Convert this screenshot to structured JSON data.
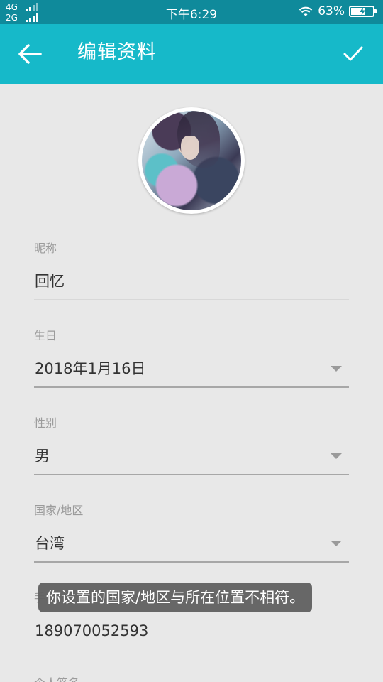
{
  "status_bar": {
    "network_top": "4G",
    "network_bottom": "2G",
    "time": "下午6:29",
    "battery_percent": "63%",
    "battery_level": 0.63,
    "wifi_icon": "wifi-icon",
    "battery_icon": "battery-charging-icon"
  },
  "title_bar": {
    "title": "编辑资料",
    "back_icon": "arrow-left-icon",
    "confirm_icon": "check-icon",
    "background": "#16b9c9"
  },
  "avatar": {
    "alt": "avatar"
  },
  "form": {
    "nickname": {
      "label": "昵称",
      "value": "回忆"
    },
    "birthday": {
      "label": "生日",
      "value": "2018年1月16日"
    },
    "gender": {
      "label": "性别",
      "value": "男"
    },
    "region": {
      "label": "国家/地区",
      "value": "台湾"
    },
    "phone": {
      "label": "手机",
      "value": "189070052593"
    },
    "signature": {
      "label": "个人签名"
    }
  },
  "toast": {
    "message": "你设置的国家/地区与所在位置不相符。"
  }
}
